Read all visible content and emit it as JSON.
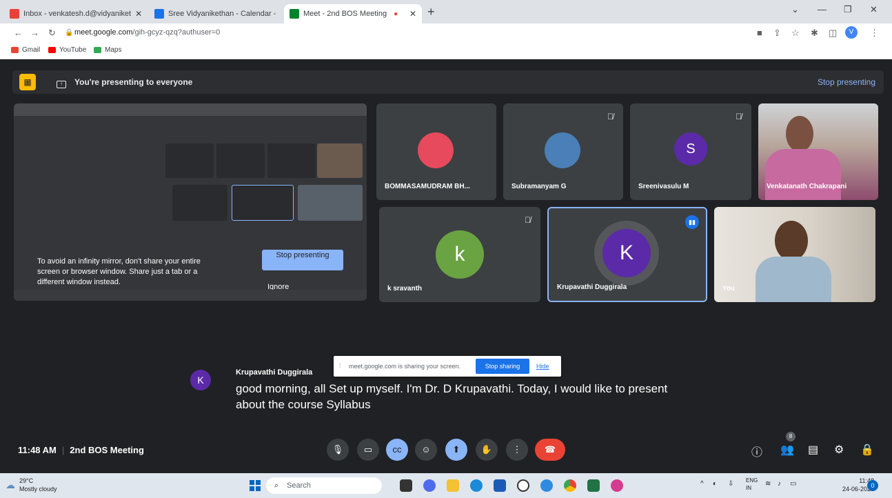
{
  "browser": {
    "tabs": [
      {
        "title": "Inbox - venkatesh.d@vidyaniket",
        "favicon_color": "#ea4335"
      },
      {
        "title": "Sree Vidyanikethan - Calendar -",
        "favicon_color": "#1a73e8"
      },
      {
        "title": "Meet - 2nd BOS Meeting",
        "favicon_color": "#00832d",
        "active": true
      }
    ],
    "new_tab": "+",
    "url_host": "meet.google.com",
    "url_path": "/gih-gcyz-qzq?authuser=0",
    "profile_initial": "V",
    "bookmarks": [
      {
        "label": "Gmail",
        "color": "#ea4335"
      },
      {
        "label": "YouTube",
        "color": "#ff0000"
      },
      {
        "label": "Maps",
        "color": "#34a853"
      }
    ]
  },
  "meet": {
    "present_banner": "You're presenting to everyone",
    "stop_presenting_link": "Stop presenting",
    "mirror": {
      "warning": "To avoid an infinity mirror, don't share your entire screen or browser window. Share just a tab or a different window instead.",
      "stop_button": "Stop presenting",
      "ignore": "Ignore"
    },
    "participants": [
      {
        "name": "BOMMASAMUDRAM BH...",
        "kind": "photo-avatar",
        "muted": false
      },
      {
        "name": "Subramanyam G",
        "kind": "photo-avatar",
        "muted": true
      },
      {
        "name": "Sreenivasulu M",
        "initial": "S",
        "color": "#5b2aa8",
        "muted": true
      },
      {
        "name": "Venkatanath Chakrapani",
        "kind": "video"
      },
      {
        "name": "k sravanth",
        "initial": "k",
        "color": "#6aa341",
        "muted": true
      },
      {
        "name": "Krupavathi Duggirala",
        "initial": "K",
        "color": "#5b2aa8",
        "speaking": true
      },
      {
        "name": "You",
        "kind": "video"
      }
    ],
    "caption": {
      "speaker": "Krupavathi Duggirala",
      "speaker_initial": "K",
      "text": "good morning, all Set up myself. I'm Dr. D Krupavathi. Today, I would like to present about the course Syllabus"
    },
    "share_banner": {
      "message": "meet.google.com is sharing your screen.",
      "stop_button": "Stop sharing",
      "hide": "Hide"
    },
    "bottom": {
      "time": "11:48 AM",
      "meeting_title": "2nd BOS Meeting",
      "participant_count": "8"
    }
  },
  "taskbar": {
    "temperature": "29°C",
    "weather": "Mostly cloudy",
    "search_placeholder": "Search",
    "lang1": "ENG",
    "lang2": "IN",
    "time": "11:48",
    "date": "24-06-2023",
    "notification_count": "0"
  }
}
